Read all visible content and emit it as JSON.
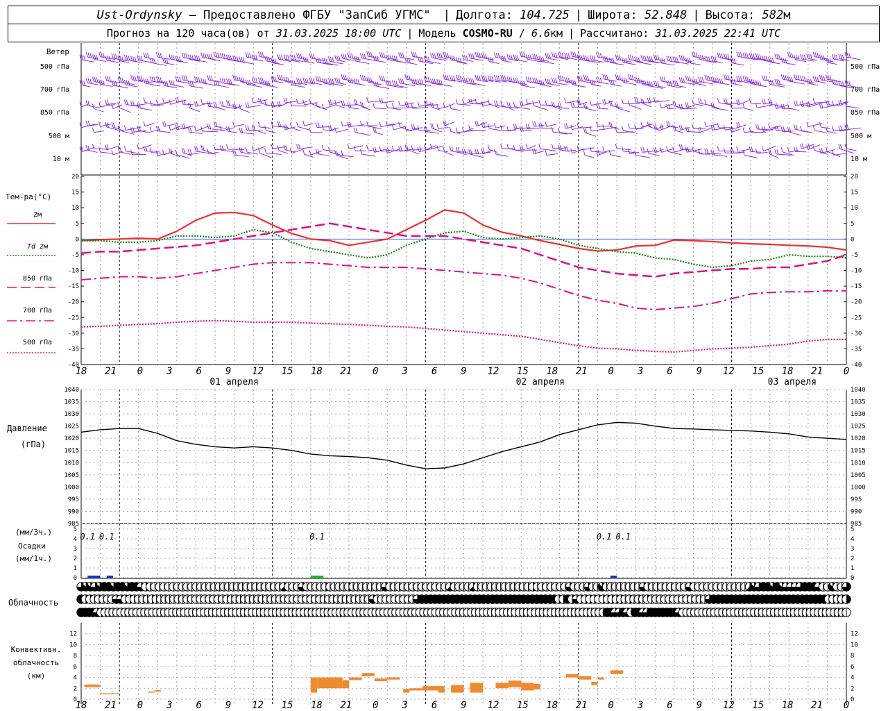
{
  "header": {
    "location": "Ust-Ordynsky",
    "provider": " — Предоставлено ФГБУ \"ЗапСиб УГМС\" ",
    "lon_label": "Долгота: ",
    "lon_value": "104.725",
    "lat_label": "Широта: ",
    "lat_value": "52.848",
    "alt_label": "Высота: ",
    "alt_value": "582",
    "alt_unit": "м",
    "forecast_label": "Прогноз на 120 часа(ов) от ",
    "forecast_start": "31.03.2025 18:00 UTC",
    "model_label": "Модель ",
    "model_name": "COSMO-RU",
    "model_sep": " / ",
    "model_res": "6.6",
    "model_res_unit": "км",
    "calc_label": "Рассчитано: ",
    "calc_time": "31.03.2025 22:41 UTC"
  },
  "time_axis": {
    "tick_labels": [
      "18",
      "21",
      "0",
      "3",
      "6",
      "9",
      "12",
      "15",
      "18",
      "21",
      "0",
      "3",
      "6",
      "9",
      "12",
      "15",
      "18",
      "21",
      "0",
      "3",
      "6",
      "9",
      "12",
      "15",
      "18",
      "21",
      "0"
    ],
    "day_labels": [
      "01 апреля",
      "02 апреля",
      "03 апреля"
    ]
  },
  "wind_panel": {
    "title": "Ветер",
    "levels": [
      "500 гПа",
      "700 гПа",
      "850 гПа",
      "500 м",
      "10  м"
    ],
    "color": "#8a2be2"
  },
  "chart_data": [
    {
      "type": "line",
      "panel": "temperature",
      "ylabel": "Тем-ра(°C)",
      "ylim": [
        -40,
        20
      ],
      "yticks": [
        20,
        15,
        10,
        5,
        0,
        -5,
        -10,
        -15,
        -20,
        -25,
        -30,
        -35,
        -40
      ],
      "x_hours": [
        0,
        3,
        6,
        9,
        12,
        15,
        18,
        21,
        24,
        27,
        30,
        33,
        36,
        39,
        42,
        45,
        48,
        51,
        54,
        57,
        60,
        63,
        66,
        69,
        72,
        75,
        78,
        81,
        84,
        87,
        90,
        93,
        96,
        99,
        102,
        105,
        108,
        111,
        114,
        117,
        120
      ],
      "series": [
        {
          "name": "2м",
          "color": "#ee3030",
          "dash": "solid",
          "values": [
            -0.5,
            -0.2,
            0,
            0.3,
            0,
            2.5,
            6,
            8.3,
            8.5,
            7.5,
            4.5,
            1.8,
            0,
            -0.5,
            -2,
            -1,
            0,
            3,
            6,
            9.3,
            8.3,
            4.5,
            2.2,
            1,
            -0.5,
            -1.7,
            -3,
            -3.8,
            -3.5,
            -2.2,
            -2,
            -0.3,
            -0.5,
            -0.8,
            -1.2,
            -1.5,
            -1.7,
            -2,
            -2.2,
            -2.6,
            -3.5
          ]
        },
        {
          "name": "Td  2м",
          "color": "#118811",
          "dash": "dotted",
          "values": [
            -0.5,
            -0.5,
            -1,
            -1,
            -0.5,
            1,
            1,
            0.5,
            1,
            3,
            2,
            -1,
            -3,
            -4,
            -5,
            -6,
            -5,
            -2,
            0,
            2,
            2.5,
            0.5,
            0,
            0.5,
            1,
            0,
            -2,
            -3,
            -4,
            -4.5,
            -6,
            -6.5,
            -8,
            -9,
            -8.5,
            -7,
            -6.5,
            -5,
            -5.5,
            -5.5,
            -6
          ]
        },
        {
          "name": "850 гПа",
          "color": "#dd1188",
          "dash": "dash",
          "values": [
            -4.5,
            -4,
            -4,
            -3.5,
            -3,
            -2.5,
            -2,
            -1,
            0,
            1,
            2,
            3,
            4,
            5,
            4,
            3,
            2,
            1,
            1,
            1,
            0,
            -1,
            -2,
            -3,
            -5,
            -7,
            -9,
            -10,
            -11,
            -11.5,
            -12,
            -11,
            -10.5,
            -10,
            -9.5,
            -9.5,
            -9,
            -9,
            -8,
            -7,
            -5
          ]
        },
        {
          "name": "700 гПа",
          "color": "#dd1188",
          "dash": "dashdot",
          "values": [
            -13,
            -12.5,
            -12,
            -12,
            -12.5,
            -12,
            -11,
            -10,
            -9,
            -8,
            -7.5,
            -7.5,
            -7.5,
            -8,
            -8.5,
            -9,
            -9,
            -9,
            -9.5,
            -10,
            -10.5,
            -11,
            -11.5,
            -12.5,
            -14,
            -16,
            -18,
            -19.5,
            -20.5,
            -22,
            -22.5,
            -22,
            -21.5,
            -20.5,
            -19,
            -17.5,
            -17,
            -16.8,
            -16.8,
            -16.5,
            -16.5
          ]
        },
        {
          "name": "500 гПа",
          "color": "#dd1188",
          "dash": "densedot",
          "values": [
            -28,
            -27.8,
            -27.5,
            -27.2,
            -27,
            -26.5,
            -26.2,
            -26,
            -26.2,
            -26.5,
            -26.5,
            -26.5,
            -26.8,
            -27,
            -27.2,
            -27.5,
            -27.8,
            -28,
            -28.5,
            -29,
            -29.5,
            -30,
            -30.5,
            -31,
            -32,
            -33,
            -34,
            -34.8,
            -35,
            -35.5,
            -35.8,
            -36,
            -35.5,
            -35,
            -34.8,
            -34.5,
            -34,
            -33.5,
            -32.5,
            -32,
            -32
          ]
        }
      ]
    },
    {
      "type": "line",
      "panel": "pressure",
      "ylabel": "Давление",
      "ylabel2": "(гПа)",
      "ylim": [
        985,
        1040
      ],
      "yticks": [
        1040,
        1035,
        1030,
        1025,
        1020,
        1015,
        1010,
        1005,
        1000,
        995,
        990,
        985
      ],
      "x_hours": [
        0,
        3,
        6,
        9,
        12,
        15,
        18,
        21,
        24,
        27,
        30,
        33,
        36,
        39,
        42,
        45,
        48,
        51,
        54,
        57,
        60,
        63,
        66,
        69,
        72,
        75,
        78,
        81,
        84,
        87,
        90,
        93,
        96,
        99,
        102,
        105,
        108,
        111,
        114,
        117,
        120
      ],
      "series": [
        {
          "name": "Давление",
          "color": "#000000",
          "values": [
            1022.5,
            1023.5,
            1024,
            1024,
            1022,
            1019,
            1017.5,
            1016.5,
            1016,
            1016.5,
            1016,
            1015,
            1013.5,
            1012.8,
            1012.5,
            1012,
            1011,
            1009,
            1007.5,
            1007.8,
            1009.5,
            1012,
            1014.5,
            1016.5,
            1018.5,
            1021.5,
            1023.5,
            1025.5,
            1026.5,
            1026.2,
            1025,
            1024,
            1023.8,
            1023.5,
            1023.2,
            1023,
            1022.5,
            1021.8,
            1020.5,
            1020,
            1019.5
          ]
        }
      ]
    },
    {
      "type": "bar",
      "panel": "precipitation",
      "ylabel": "(мм/3ч.)",
      "ylabel2": "Осадки",
      "ylabel3": "(мм/1ч.)",
      "ylim": [
        0,
        5
      ],
      "yticks": [
        5,
        4,
        3,
        2,
        1,
        0
      ],
      "amount_labels": [
        {
          "hour": 1,
          "text": "0.1"
        },
        {
          "hour": 4,
          "text": "0.1"
        },
        {
          "hour": 37,
          "text": "0.1"
        },
        {
          "hour": 82,
          "text": "0.1"
        },
        {
          "hour": 85,
          "text": "0.1"
        }
      ],
      "bars": [
        {
          "start": 1,
          "end": 3,
          "value": 0.1,
          "color": "#1030d0"
        },
        {
          "start": 4,
          "end": 5,
          "value": 0.05,
          "color": "#1030d0"
        },
        {
          "start": 36,
          "end": 38,
          "value": 0.15,
          "color": "#10c010"
        },
        {
          "start": 83,
          "end": 84,
          "value": 0.05,
          "color": "#1030d0"
        }
      ]
    },
    {
      "type": "table",
      "panel": "cloudiness",
      "ylabel": "Облачность",
      "rows": [
        [
          6,
          7,
          7,
          6,
          7,
          8,
          8,
          7,
          8,
          8,
          7,
          8,
          8,
          6,
          4,
          0,
          0,
          0,
          0,
          0,
          0,
          0,
          0,
          0,
          0,
          0,
          0,
          0,
          0,
          0,
          0,
          0,
          0,
          0,
          0,
          0,
          0,
          0,
          0,
          0,
          0,
          0,
          0,
          0,
          5,
          0,
          0,
          0,
          6,
          0,
          0,
          0,
          0,
          4,
          0,
          0,
          0,
          0,
          4,
          0,
          0,
          0,
          0,
          0,
          0,
          0,
          6,
          0,
          0,
          0,
          0,
          0,
          0,
          0,
          0,
          0,
          0,
          0,
          0,
          0,
          5,
          0,
          0,
          0,
          0,
          5,
          0,
          0,
          0,
          0,
          0,
          0,
          0,
          0,
          0,
          0,
          0,
          0,
          4,
          0,
          0,
          0,
          0,
          0,
          0,
          0,
          6,
          0,
          0,
          0,
          6,
          0,
          0,
          7,
          0,
          0,
          0,
          0,
          0,
          0,
          0,
          0,
          6,
          0,
          0,
          0,
          0,
          0,
          0,
          0,
          0,
          0,
          6,
          0,
          0,
          0,
          0,
          0,
          0,
          0,
          0,
          0,
          0,
          0,
          0,
          5,
          7,
          6,
          8,
          8,
          7,
          8,
          7,
          6,
          6,
          6,
          6,
          8,
          8,
          8,
          6,
          0,
          0,
          7,
          0,
          0,
          6
        ],
        [
          8,
          4,
          2,
          0,
          4,
          0,
          0,
          0,
          6,
          6,
          4,
          4,
          0,
          0,
          0,
          0,
          4,
          0,
          0,
          0,
          0,
          0,
          0,
          0,
          0,
          0,
          0,
          0,
          0,
          0,
          0,
          0,
          0,
          0,
          0,
          0,
          0,
          0,
          0,
          0,
          0,
          0,
          0,
          0,
          0,
          0,
          0,
          0,
          0,
          0,
          0,
          0,
          0,
          0,
          0,
          0,
          0,
          0,
          0,
          0,
          0,
          0,
          0,
          0,
          0,
          0,
          6,
          0,
          0,
          0,
          0,
          0,
          0,
          0,
          0,
          0,
          6,
          8,
          8,
          8,
          8,
          8,
          8,
          8,
          8,
          8,
          8,
          8,
          8,
          8,
          8,
          8,
          8,
          8,
          8,
          8,
          8,
          8,
          8,
          8,
          8,
          8,
          8,
          8,
          8,
          8,
          8,
          8,
          4,
          4,
          8,
          4,
          6,
          4,
          4,
          4,
          4,
          2,
          4,
          4,
          4,
          4,
          4,
          0,
          4,
          0,
          4,
          0,
          2,
          0,
          0,
          0,
          0,
          0,
          0,
          0,
          0,
          0,
          0,
          0,
          0,
          0,
          6,
          8,
          8,
          8,
          8,
          8,
          8,
          8,
          8,
          8,
          8,
          8,
          8,
          8,
          8,
          8,
          8,
          8,
          8,
          8,
          8,
          8,
          8,
          8,
          8,
          8,
          8,
          4,
          4,
          4,
          4,
          4
        ],
        [
          8,
          8,
          8,
          8,
          6,
          4,
          0,
          0,
          0,
          0,
          0,
          0,
          0,
          0,
          0,
          0,
          0,
          0,
          0,
          0,
          0,
          0,
          0,
          0,
          0,
          0,
          0,
          0,
          0,
          0,
          0,
          0,
          0,
          0,
          0,
          0,
          0,
          0,
          0,
          0,
          0,
          0,
          0,
          0,
          0,
          0,
          0,
          0,
          0,
          0,
          0,
          0,
          0,
          0,
          0,
          0,
          0,
          0,
          0,
          0,
          0,
          0,
          0,
          0,
          0,
          0,
          0,
          0,
          0,
          0,
          0,
          0,
          0,
          0,
          0,
          0,
          0,
          0,
          0,
          0,
          0,
          0,
          0,
          0,
          0,
          0,
          0,
          0,
          0,
          0,
          0,
          0,
          0,
          0,
          0,
          0,
          0,
          0,
          0,
          0,
          0,
          0,
          0,
          0,
          0,
          0,
          0,
          0,
          0,
          0,
          0,
          0,
          0,
          0,
          0,
          0,
          0,
          0,
          0,
          0,
          0,
          0,
          0,
          0,
          0,
          0,
          0,
          0,
          0,
          0,
          0,
          0,
          8,
          8,
          6,
          6,
          8,
          6,
          2,
          8,
          8,
          6,
          6,
          8,
          8,
          8,
          8,
          8,
          8,
          8,
          6,
          0,
          0,
          0,
          0,
          0,
          0,
          0,
          0,
          0,
          0,
          0,
          0,
          0,
          0,
          0,
          0,
          0,
          0,
          0,
          0,
          0,
          0,
          0,
          0,
          0,
          0,
          0,
          0,
          0,
          0,
          0,
          0,
          0,
          0,
          0,
          0,
          0,
          0,
          0,
          0,
          0,
          0
        ]
      ]
    },
    {
      "type": "bar",
      "panel": "convective_cloud",
      "ylabel": "Конвективн.",
      "ylabel2": "облачность",
      "ylabel3": "(км)",
      "ylim": [
        0,
        14
      ],
      "yticks": [
        12,
        10,
        8,
        6,
        4,
        2,
        0
      ],
      "color": "#f08a30",
      "bars": [
        {
          "start": 0.5,
          "end": 3,
          "bottom": 2.2,
          "top": 2.7
        },
        {
          "start": 3,
          "end": 6,
          "bottom": 1.0,
          "top": 1.1
        },
        {
          "start": 10.5,
          "end": 11.5,
          "bottom": 1.2,
          "top": 1.4
        },
        {
          "start": 11.5,
          "end": 12.5,
          "bottom": 1.4,
          "top": 1.7
        },
        {
          "start": 36,
          "end": 37,
          "bottom": 1.2,
          "top": 4.0
        },
        {
          "start": 37,
          "end": 41,
          "bottom": 2.0,
          "top": 4.0
        },
        {
          "start": 41,
          "end": 42,
          "bottom": 2.0,
          "top": 3.5
        },
        {
          "start": 42,
          "end": 44,
          "bottom": 3.5,
          "top": 4.0
        },
        {
          "start": 44,
          "end": 46,
          "bottom": 4.2,
          "top": 4.8
        },
        {
          "start": 46,
          "end": 48,
          "bottom": 3.3,
          "top": 3.8
        },
        {
          "start": 48,
          "end": 50,
          "bottom": 3.6,
          "top": 4.0
        },
        {
          "start": 50.5,
          "end": 51.5,
          "bottom": 1.2,
          "top": 1.9
        },
        {
          "start": 51.5,
          "end": 53.5,
          "bottom": 1.6,
          "top": 2.0
        },
        {
          "start": 53.5,
          "end": 56,
          "bottom": 1.6,
          "top": 2.4
        },
        {
          "start": 56,
          "end": 57,
          "bottom": 1.2,
          "top": 2.4
        },
        {
          "start": 58,
          "end": 60,
          "bottom": 1.2,
          "top": 2.6
        },
        {
          "start": 61,
          "end": 63,
          "bottom": 1.2,
          "top": 3.0
        },
        {
          "start": 65,
          "end": 67,
          "bottom": 2.0,
          "top": 3.0
        },
        {
          "start": 67,
          "end": 69,
          "bottom": 2.2,
          "top": 3.4
        },
        {
          "start": 69,
          "end": 71,
          "bottom": 1.6,
          "top": 3.0
        },
        {
          "start": 71,
          "end": 72,
          "bottom": 1.8,
          "top": 2.8
        },
        {
          "start": 76,
          "end": 78,
          "bottom": 4.0,
          "top": 4.6
        },
        {
          "start": 78,
          "end": 80,
          "bottom": 3.6,
          "top": 4.2
        },
        {
          "start": 80,
          "end": 81,
          "bottom": 2.6,
          "top": 3.2
        },
        {
          "start": 81,
          "end": 82,
          "bottom": 3.6,
          "top": 4.0
        },
        {
          "start": 83,
          "end": 85,
          "bottom": 4.6,
          "top": 5.3
        }
      ]
    }
  ]
}
